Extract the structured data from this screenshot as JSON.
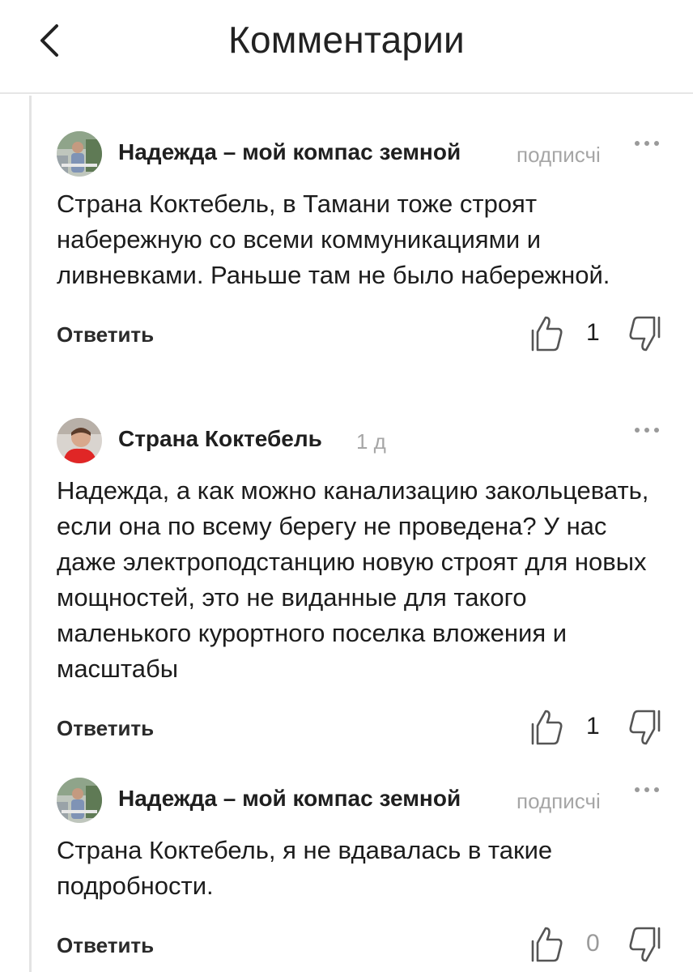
{
  "header": {
    "title": "Комментарии",
    "back_icon": "chevron-left-icon"
  },
  "comments": [
    {
      "author": "Надежда – мой компас земной",
      "meta": "подписчі",
      "text": "Страна Коктебель, в Тамани тоже строят набережную со всеми коммуникациями и ливневками. Раньше там не было набережной.",
      "reply_label": "Ответить",
      "likes": "1"
    },
    {
      "author": "Страна Коктебель",
      "meta": "1 д",
      "text": "Надежда, а как можно канализацию закольцевать, если она по всему берегу не проведена? У нас даже электроподстанцию новую строят для новых мощностей, это не виданные для такого маленького курортного поселка вложения и масштабы",
      "reply_label": "Ответить",
      "likes": "1"
    },
    {
      "author": "Надежда – мой компас земной",
      "meta": "подписчі",
      "text": "Страна Коктебель, я не вдавалась в такие подробности.",
      "reply_label": "Ответить",
      "likes": "0"
    }
  ],
  "colors": {
    "text": "#1c1c1c",
    "meta": "#a6a6a6",
    "divider": "#e3e3e3",
    "icon": "#555555"
  }
}
